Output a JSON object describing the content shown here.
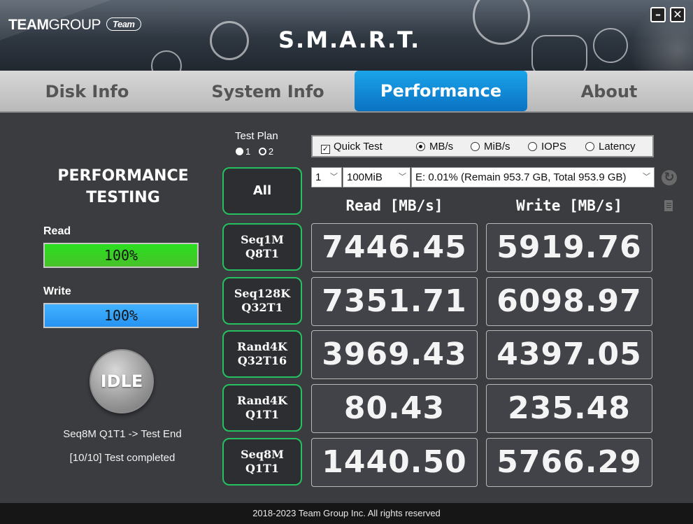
{
  "header": {
    "brand_main": "TEAM",
    "brand_sub": "GROUP",
    "brand_badge": "Team",
    "app_title": "S.M.A.R.T.",
    "minimize_label": "–",
    "close_label": "✕"
  },
  "tabs": [
    {
      "label": "Disk Info",
      "active": false
    },
    {
      "label": "System Info",
      "active": false
    },
    {
      "label": "Performance",
      "active": true
    },
    {
      "label": "About",
      "active": false
    }
  ],
  "left_panel": {
    "heading_line1": "PERFORMANCE",
    "heading_line2": "TESTING",
    "read_label": "Read",
    "read_percent_text": "100%",
    "read_progress": 100,
    "write_label": "Write",
    "write_percent_text": "100%",
    "write_progress": 100,
    "idle_label": "IDLE",
    "status_line1": "Seq8M Q1T1 -> Test End",
    "status_line2": "[10/10] Test completed"
  },
  "test_plan": {
    "title": "Test Plan",
    "options": [
      "1",
      "2"
    ],
    "selected": "1"
  },
  "options": {
    "quick_test_label": "Quick Test",
    "quick_test_checked": true,
    "units": [
      "MB/s",
      "MiB/s",
      "IOPS",
      "Latency"
    ],
    "selected_unit": "MB/s"
  },
  "selects": {
    "count": "1",
    "size": "100MiB",
    "drive": "E: 0.01% (Remain 953.7 GB, Total 953.9 GB)"
  },
  "columns": {
    "read": "Read [MB/s]",
    "write": "Write [MB/s]"
  },
  "tests": {
    "all_label": "All",
    "rows": [
      {
        "name_line1": "Seq1M",
        "name_line2": "Q8T1",
        "read": "7446.45",
        "write": "5919.76"
      },
      {
        "name_line1": "Seq128K",
        "name_line2": "Q32T1",
        "read": "7351.71",
        "write": "6098.97"
      },
      {
        "name_line1": "Rand4K",
        "name_line2": "Q32T16",
        "read": "3969.43",
        "write": "4397.05"
      },
      {
        "name_line1": "Rand4K",
        "name_line2": "Q1T1",
        "read": "80.43",
        "write": "235.48"
      },
      {
        "name_line1": "Seq8M",
        "name_line2": "Q1T1",
        "read": "1440.50",
        "write": "5766.29"
      }
    ]
  },
  "footer": {
    "copyright": "2018-2023 Team Group Inc. All rights reserved"
  },
  "colors": {
    "accent_blue": "#0b72c2",
    "read_green": "#2adf1f",
    "write_blue": "#42b2ff",
    "button_border_green": "#27c060"
  }
}
